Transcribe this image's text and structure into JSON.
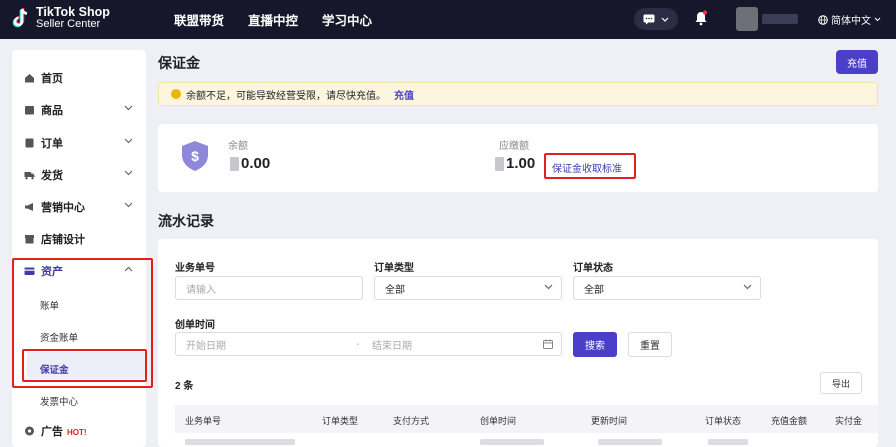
{
  "topbar": {
    "logo_line1": "TikTok Shop",
    "logo_line2": "Seller Center",
    "nav": [
      "联盟带货",
      "直播中控",
      "学习中心"
    ],
    "language": "简体中文"
  },
  "sidebar": {
    "home": "首页",
    "products": "商品",
    "orders": "订单",
    "shipping": "发货",
    "marketing": "营销中心",
    "store_design": "店铺设计",
    "assets": "资产",
    "bills": "账单",
    "fund_bills": "资金账单",
    "deposit": "保证金",
    "invoice": "发票中心",
    "ads": "广告",
    "ads_badge": "HOT!"
  },
  "page": {
    "title": "保证金",
    "recharge_button": "充值",
    "notice_text": "余额不足，可能导致经营受限，请尽快充值。",
    "notice_link": "充值"
  },
  "balance": {
    "balance_label": "余额",
    "balance_value": "0.00",
    "threshold_label": "应缴额",
    "threshold_value": "1.00",
    "standard_link": "保证金收取标准"
  },
  "records": {
    "title": "流水记录",
    "filters": {
      "business_no_label": "业务单号",
      "business_no_placeholder": "请输入",
      "order_type_label": "订单类型",
      "order_type_value": "全部",
      "order_status_label": "订单状态",
      "order_status_value": "全部",
      "created_label": "创单时间",
      "start_placeholder": "开始日期",
      "date_separator": "-",
      "end_placeholder": "结束日期"
    },
    "search_button": "搜索",
    "reset_button": "重置",
    "count": "2 条",
    "export_button": "导出",
    "columns": [
      "业务单号",
      "订单类型",
      "支付方式",
      "创单时间",
      "更新时间",
      "订单状态",
      "充值金额",
      "实付金"
    ]
  },
  "colors": {
    "topbar": "#16172b",
    "accent": "#4b3fc9",
    "highlight": "#e0211c",
    "notice_bg": "#fdf6de",
    "warning": "#f0b400"
  }
}
